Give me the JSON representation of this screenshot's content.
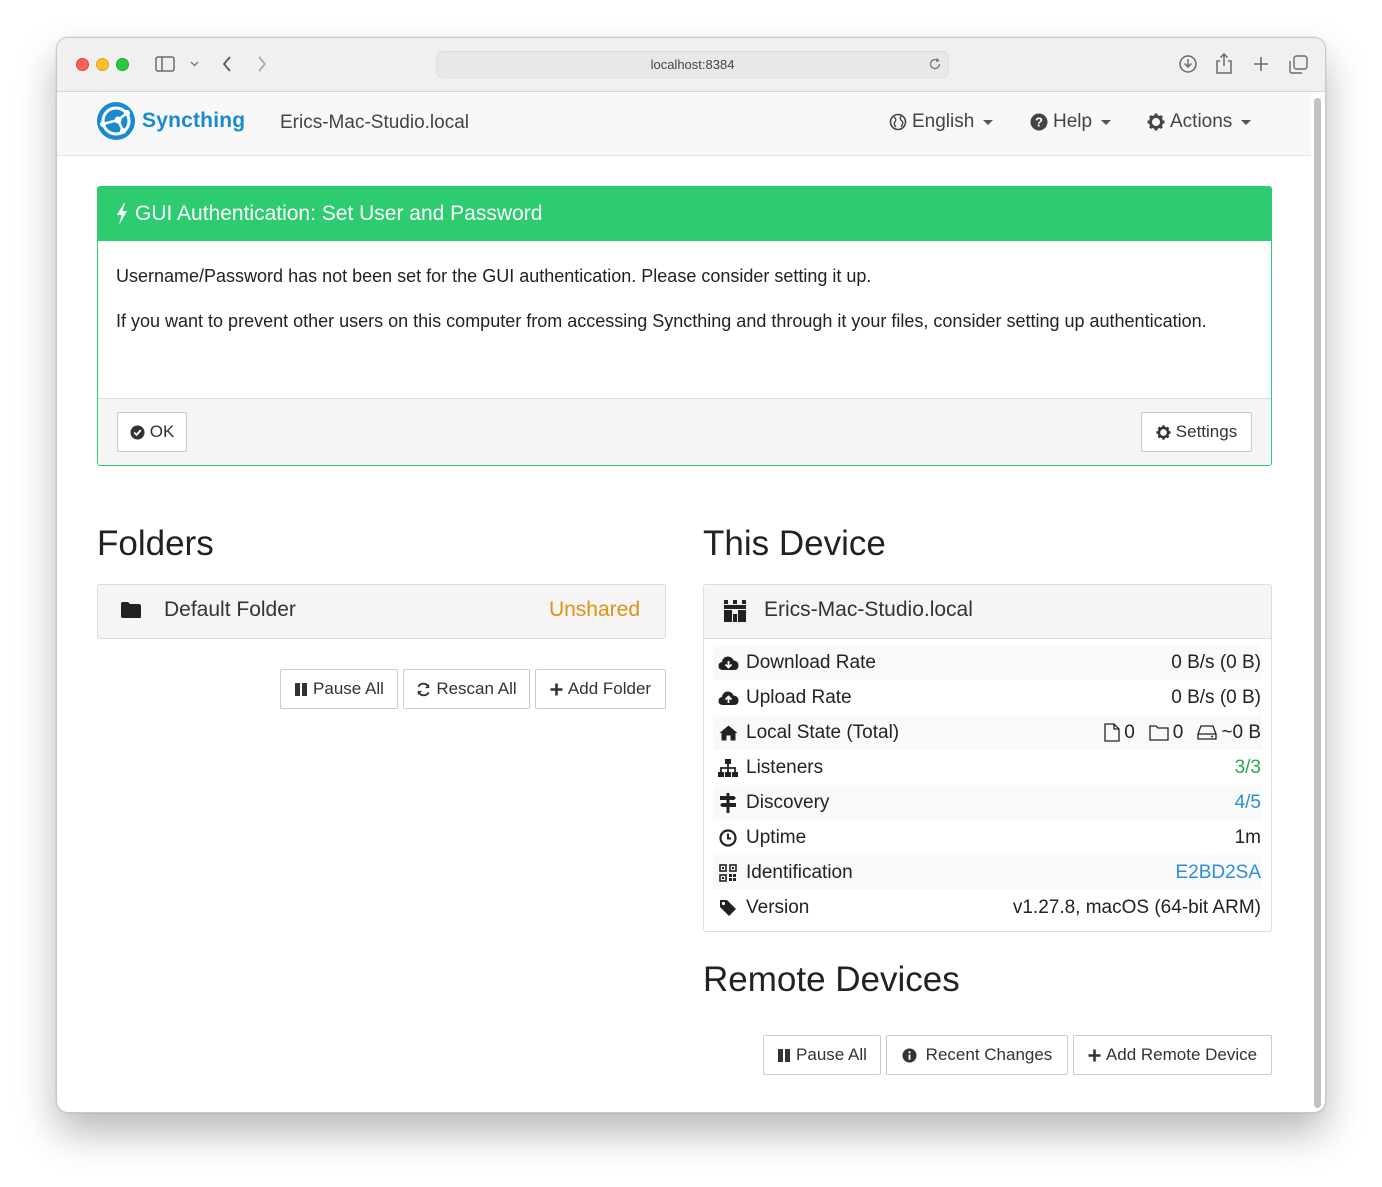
{
  "browser": {
    "url": "localhost:8384"
  },
  "navbar": {
    "brand": "Syncthing",
    "hostname": "Erics-Mac-Studio.local",
    "language": "English",
    "help": "Help",
    "actions": "Actions"
  },
  "alert": {
    "title": "GUI Authentication: Set User and Password",
    "paragraph1": "Username/Password has not been set for the GUI authentication. Please consider setting it up.",
    "paragraph2": "If you want to prevent other users on this computer from accessing Syncthing and through it your files, consider setting up authentication.",
    "ok_label": "OK",
    "settings_label": "Settings"
  },
  "folders": {
    "heading": "Folders",
    "items": [
      {
        "name": "Default Folder",
        "status": "Unshared"
      }
    ],
    "pause_all": "Pause All",
    "rescan_all": "Rescan All",
    "add_folder": "Add Folder"
  },
  "this_device": {
    "heading": "This Device",
    "name": "Erics-Mac-Studio.local",
    "rows": [
      {
        "label": "Download Rate",
        "value": "0 B/s (0 B)",
        "icon": "cloud-download-icon"
      },
      {
        "label": "Upload Rate",
        "value": "0 B/s (0 B)",
        "icon": "cloud-upload-icon"
      },
      {
        "label": "Local State (Total)",
        "files": "0",
        "dirs": "0",
        "size": "~0 B",
        "icon": "home-icon"
      },
      {
        "label": "Listeners",
        "value": "3/3",
        "icon": "sitemap-icon"
      },
      {
        "label": "Discovery",
        "value": "4/5",
        "icon": "signpost-icon"
      },
      {
        "label": "Uptime",
        "value": "1m",
        "icon": "clock-icon"
      },
      {
        "label": "Identification",
        "value": "E2BD2SA",
        "icon": "qrcode-icon"
      },
      {
        "label": "Version",
        "value": "v1.27.8, macOS (64-bit ARM)",
        "icon": "tag-icon"
      }
    ]
  },
  "remote_devices": {
    "heading": "Remote Devices",
    "pause_all": "Pause All",
    "recent_changes": "Recent Changes",
    "add_remote_device": "Add Remote Device"
  },
  "colors": {
    "brand_blue": "#1a8ad0",
    "success_green": "#2ecc71",
    "unshared_orange": "#e29112",
    "listeners_green": "#2aa84a",
    "link_blue": "#2e8fd6"
  }
}
